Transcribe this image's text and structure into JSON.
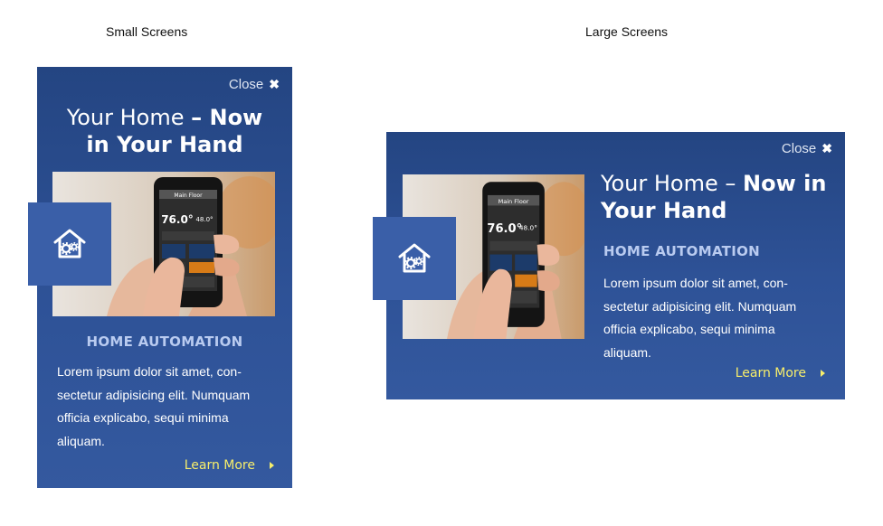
{
  "captions": {
    "small": "Small Screens",
    "large": "Large Screens"
  },
  "promo": {
    "close_label": "Close",
    "close_icon": "✖",
    "title_light": "Your Home – ",
    "title_bold": "Now in Your Hand",
    "small_title_line1_light": "Your Home ",
    "small_title_line1_bold": "– Now",
    "small_title_line2": "in Your Hand",
    "large_title_line1_light": "Your Home – ",
    "large_title_line1_bold": "Now in",
    "large_title_line2": "Your Hand",
    "subhead": "HOME AUTOMATION",
    "body": "Lorem ipsum dolor sit amet, con-sectetur adipisicing elit. Numquam officia explicabo, sequi minima aliquam.",
    "body_lines": [
      "Lorem ipsum dolor sit amet, con-",
      "sectetur adipisicing elit. Numquam",
      "officia explicabo, sequi minima",
      "aliquam."
    ],
    "learn_more": "Learn More",
    "phone_temp": "76.0°",
    "phone_set": "48.0°",
    "phone_header": "Main Floor"
  },
  "colors": {
    "card": "#2e5297",
    "accent_link": "#f7ee6b",
    "subhead": "#b9cbf0",
    "badge": "#3a5fa8"
  }
}
